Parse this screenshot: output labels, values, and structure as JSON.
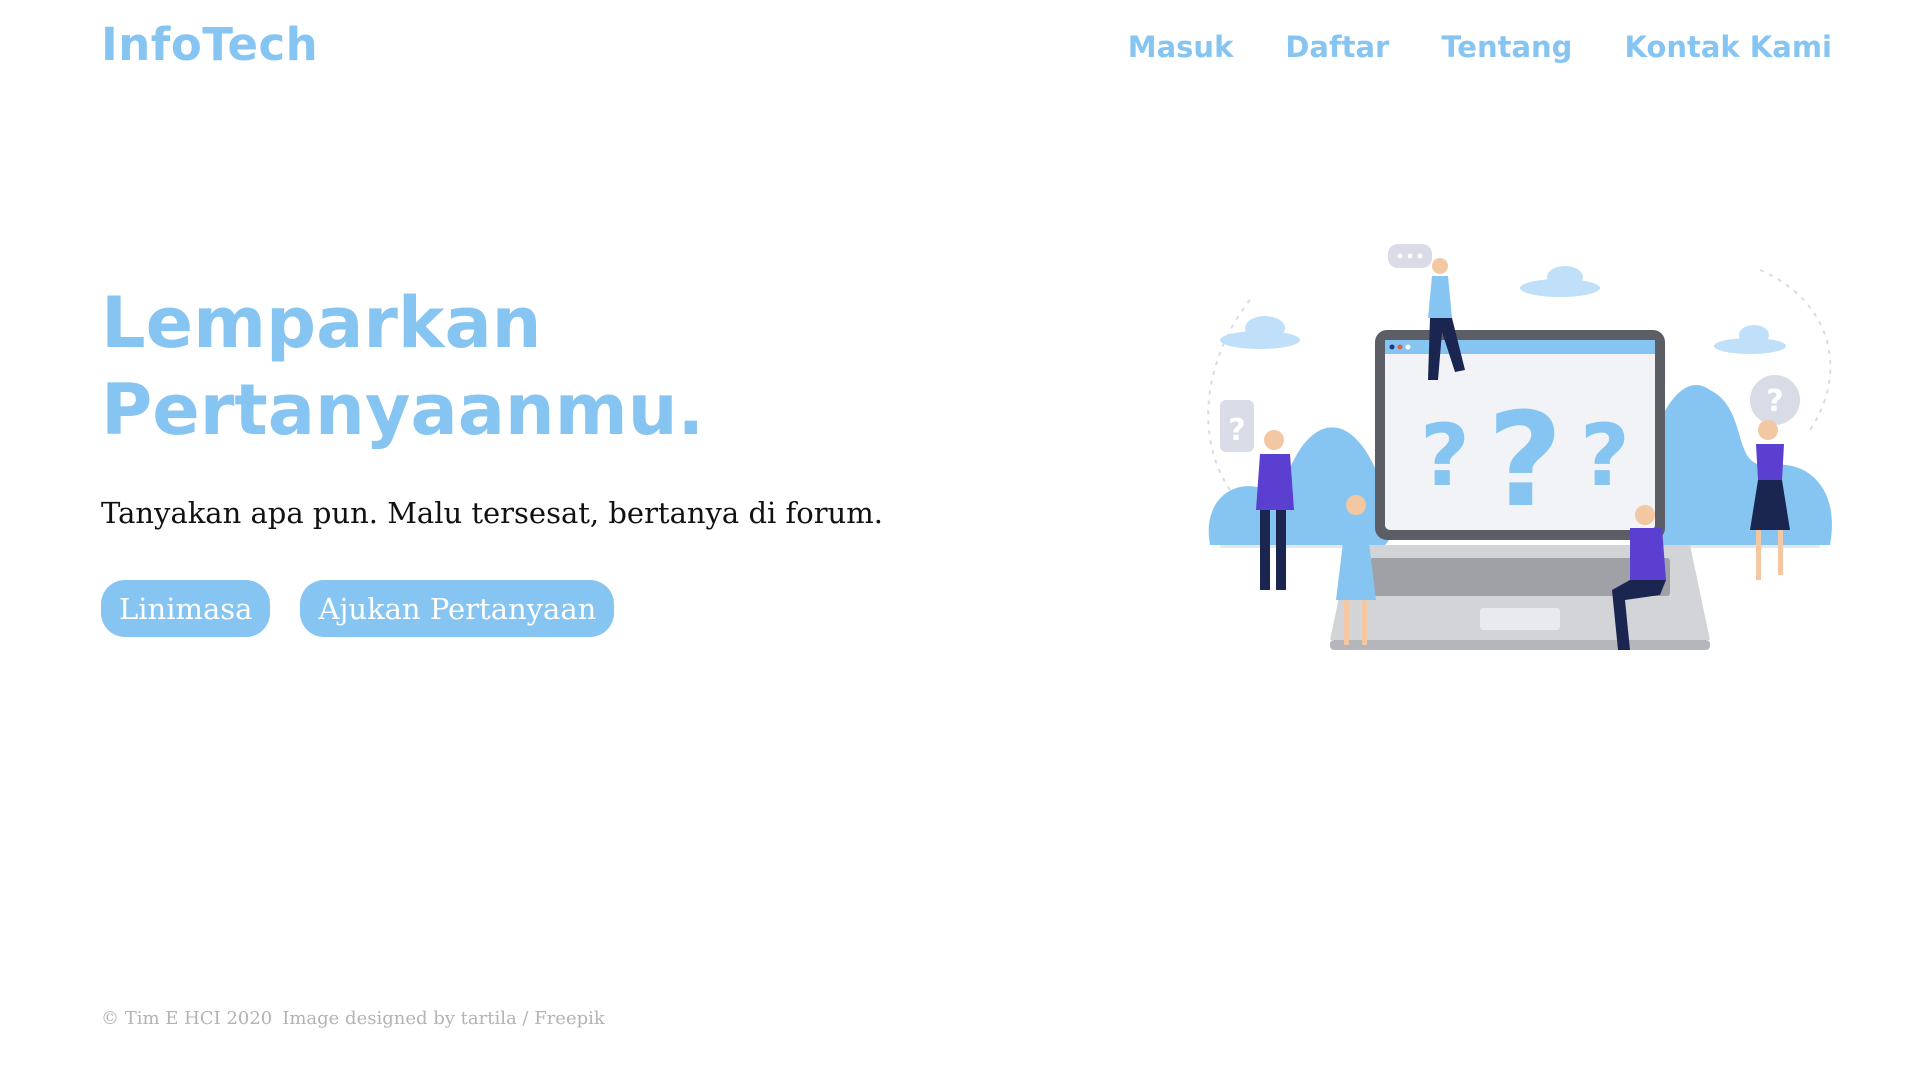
{
  "colors": {
    "accent": "#86c5f1",
    "text": "#111111",
    "muted": "#b3b3b3"
  },
  "brand": {
    "name": "InfoTech"
  },
  "nav": {
    "items": [
      {
        "label": "Masuk"
      },
      {
        "label": "Daftar"
      },
      {
        "label": "Tentang"
      },
      {
        "label": "Kontak Kami"
      }
    ]
  },
  "hero": {
    "title_line1": "Lemparkan",
    "title_line2": "Pertanyaanmu.",
    "subtitle": "Tanyakan apa pun. Malu tersesat, bertanya di forum.",
    "buttons": {
      "timeline": "Linimasa",
      "ask": "Ajukan Pertanyaan"
    }
  },
  "illustration": {
    "marks": [
      "?",
      "?",
      "?",
      "?",
      "?"
    ]
  },
  "footer": {
    "copyright": "© Tim E HCI 2020",
    "credit": "Image designed by tartila / Freepik"
  }
}
